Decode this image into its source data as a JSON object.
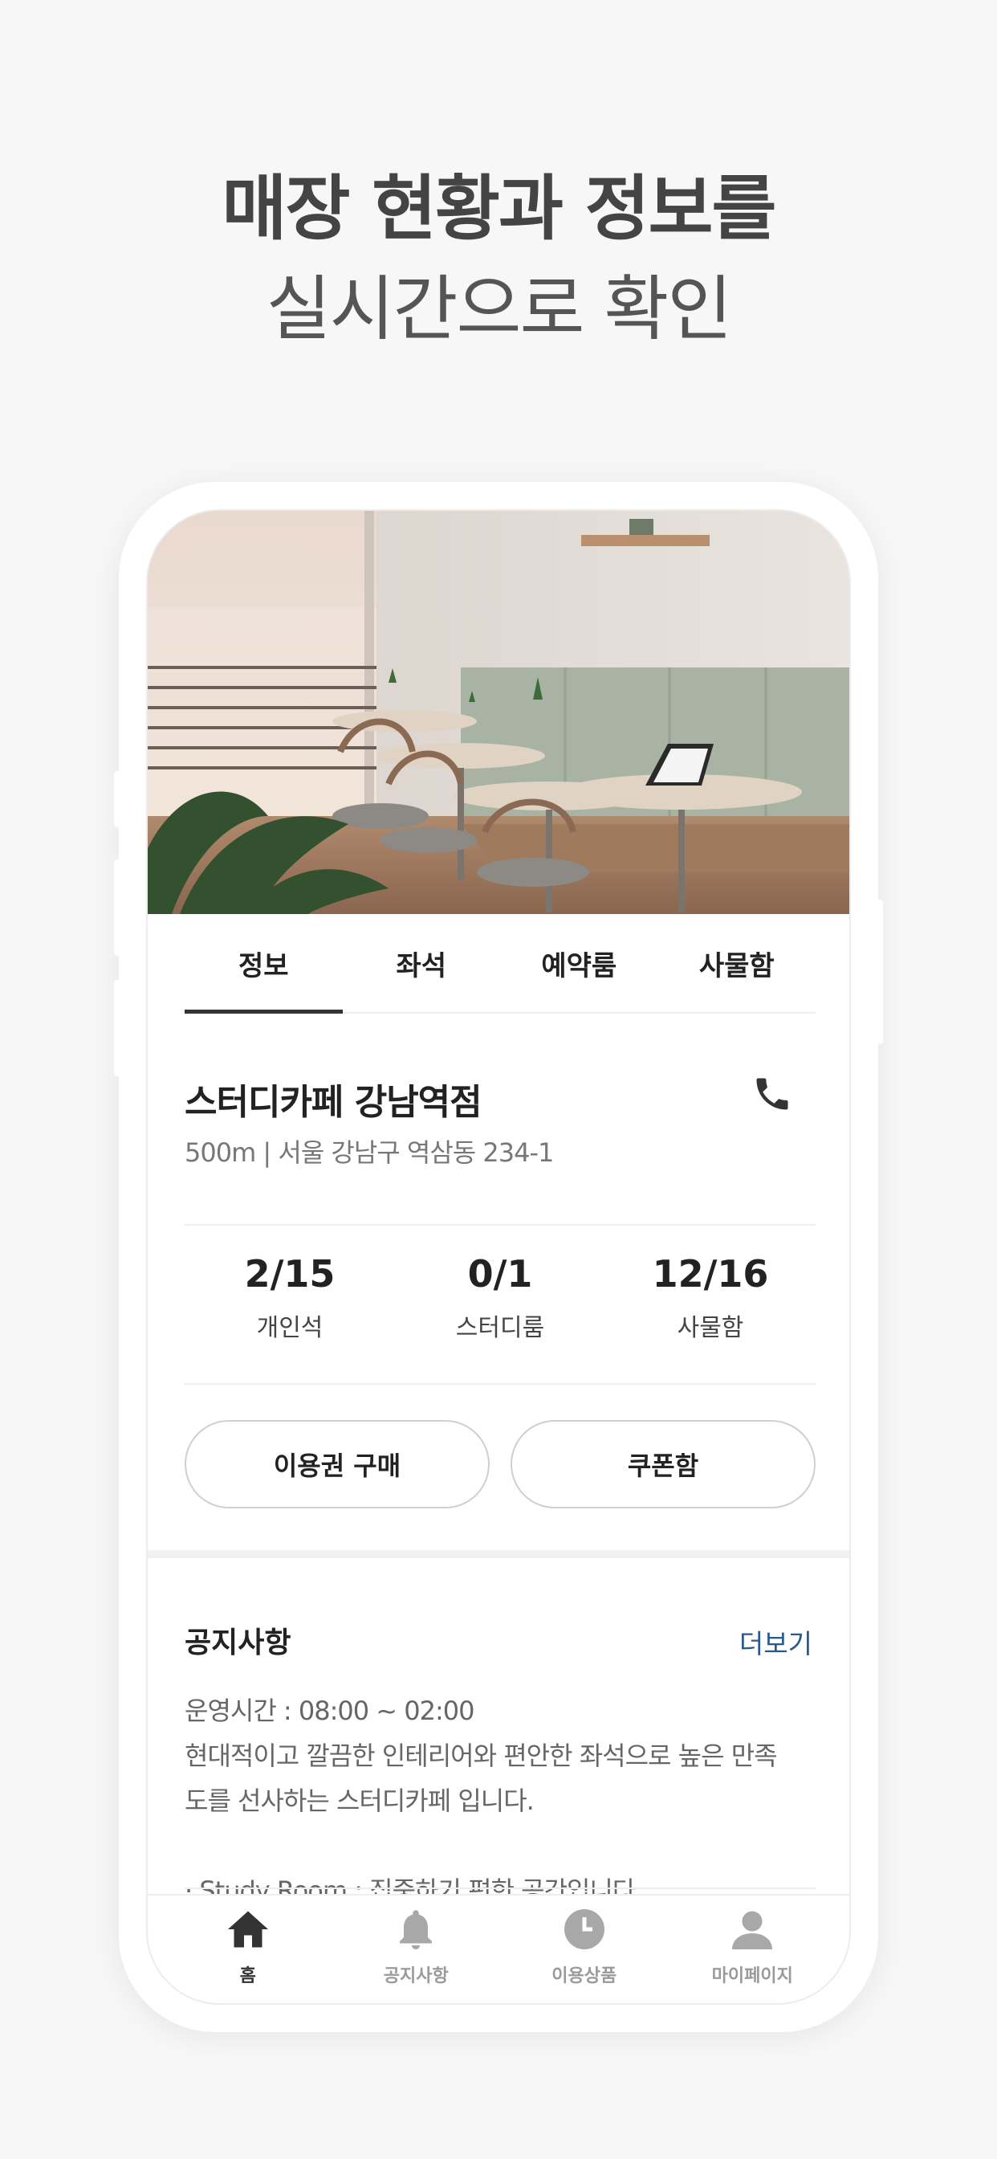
{
  "headline": {
    "line1": "매장 현황과 정보를",
    "line2": "실시간으로 확인"
  },
  "tabs": [
    {
      "label": "정보",
      "active": true
    },
    {
      "label": "좌석",
      "active": false
    },
    {
      "label": "예약룸",
      "active": false
    },
    {
      "label": "사물함",
      "active": false
    }
  ],
  "store": {
    "name": "스터디카페 강남역점",
    "address": "500m | 서울 강남구 역삼동 234-1",
    "call_icon": "phone-icon"
  },
  "stats": [
    {
      "value": "2/15",
      "label": "개인석"
    },
    {
      "value": "0/1",
      "label": "스터디룸"
    },
    {
      "value": "12/16",
      "label": "사물함"
    }
  ],
  "buttons": {
    "buy": "이용권 구매",
    "coupon": "쿠폰함"
  },
  "notice": {
    "title": "공지사항",
    "more": "더보기",
    "lines": [
      "운영시간 : 08:00 ~ 02:00",
      "현대적이고 깔끔한 인테리어와 편안한 좌석으로 높은 만족",
      "도를 선사하는 스터디카페 입니다.",
      "",
      "·  Study Room : 집중하기 편한 공간입니다"
    ]
  },
  "bottom_nav": [
    {
      "label": "홈",
      "icon": "home-icon",
      "active": true
    },
    {
      "label": "공지사항",
      "icon": "bell-icon",
      "active": false
    },
    {
      "label": "이용상품",
      "icon": "clock-icon",
      "active": false
    },
    {
      "label": "마이페이지",
      "icon": "user-icon",
      "active": false
    }
  ],
  "colors": {
    "background": "#f7f7f8",
    "accent_link": "#2a5a8c",
    "active_tab_underline": "#333333",
    "inactive_nav": "#9a9a9a"
  }
}
